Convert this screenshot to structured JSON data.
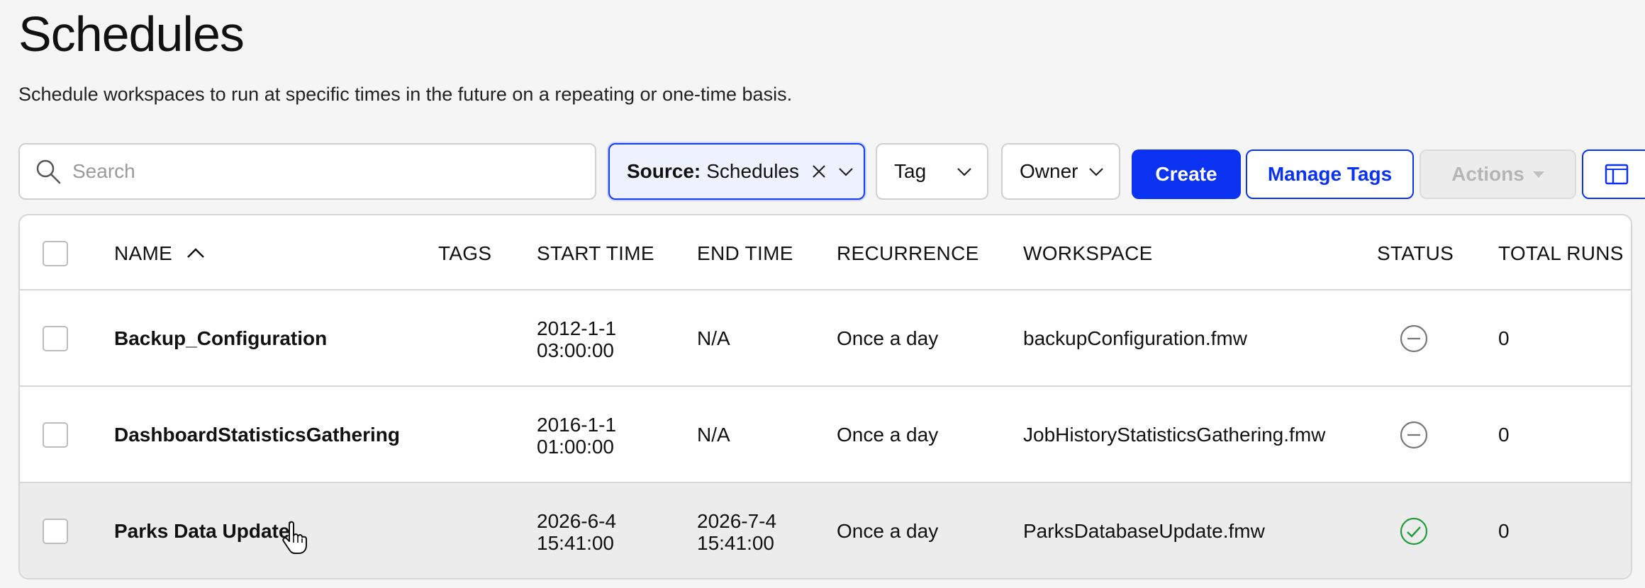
{
  "page": {
    "title": "Schedules",
    "description": "Schedule workspaces to run at specific times in the future on a repeating or one-time basis."
  },
  "toolbar": {
    "search_placeholder": "Search",
    "source_filter": {
      "key": "Source:",
      "value": "Schedules"
    },
    "tag_filter_label": "Tag",
    "owner_filter_label": "Owner",
    "create_label": "Create",
    "manage_tags_label": "Manage Tags",
    "actions_label": "Actions"
  },
  "table": {
    "headers": {
      "name": "NAME",
      "tags": "TAGS",
      "start_time": "START TIME",
      "end_time": "END TIME",
      "recurrence": "RECURRENCE",
      "workspace": "WORKSPACE",
      "status": "STATUS",
      "total_runs": "TOTAL RUNS"
    },
    "sort": {
      "column": "name",
      "direction": "ascending"
    },
    "rows": [
      {
        "name": "Backup_Configuration",
        "tags": "",
        "start_date": "2012-1-1",
        "start_clock": "03:00:00",
        "end_date": "N/A",
        "end_clock": "",
        "recurrence": "Once a day",
        "workspace": "backupConfiguration.fmw",
        "status": "disabled",
        "total_runs": "0"
      },
      {
        "name": "DashboardStatisticsGathering",
        "tags": "",
        "start_date": "2016-1-1",
        "start_clock": "01:00:00",
        "end_date": "N/A",
        "end_clock": "",
        "recurrence": "Once a day",
        "workspace": "JobHistoryStatisticsGathering.fmw",
        "status": "disabled",
        "total_runs": "0"
      },
      {
        "name": "Parks Data Update",
        "tags": "",
        "start_date": "2026-6-4",
        "start_clock": "15:41:00",
        "end_date": "2026-7-4",
        "end_clock": "15:41:00",
        "recurrence": "Once a day",
        "workspace": "ParksDatabaseUpdate.fmw",
        "status": "enabled",
        "total_runs": "0"
      }
    ]
  },
  "colors": {
    "accent": "#0a32f0",
    "status_enabled": "#1e9e3a",
    "status_disabled": "#777777"
  },
  "icons": {
    "search": "search-icon",
    "clear": "close-icon",
    "dropdown": "chevron-down-icon",
    "sort": "chevron-up-icon",
    "columns": "columns-panel-icon",
    "disabled": "minus-circle-icon",
    "enabled": "check-circle-icon",
    "cursor": "hand-pointer-icon"
  }
}
